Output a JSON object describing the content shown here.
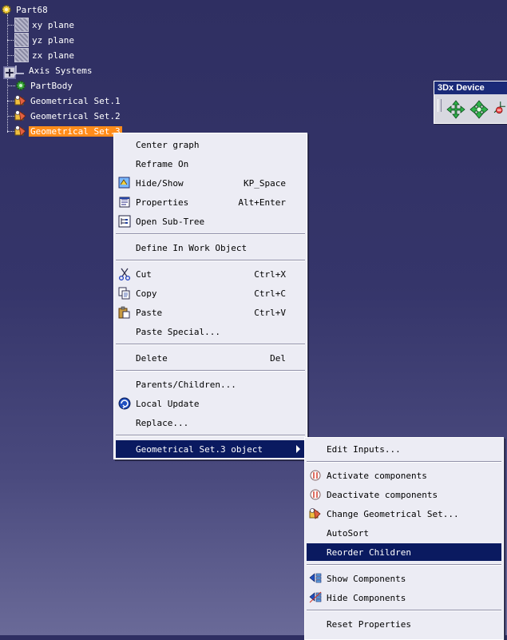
{
  "tree": {
    "root": "Part68",
    "nodes": [
      {
        "label": "xy plane",
        "icon": "plane-icon"
      },
      {
        "label": "yz plane",
        "icon": "plane-icon"
      },
      {
        "label": "zx plane",
        "icon": "plane-icon"
      },
      {
        "label": "Axis Systems",
        "icon": "axis-systems-icon"
      },
      {
        "label": "PartBody",
        "icon": "partbody-gear-icon"
      },
      {
        "label": "Geometrical Set.1",
        "icon": "geometrical-set-icon"
      },
      {
        "label": "Geometrical Set.2",
        "icon": "geometrical-set-icon"
      },
      {
        "label": "Geometrical Set.3",
        "icon": "geometrical-set-icon"
      }
    ]
  },
  "toolbar": {
    "title": "3Dx Device",
    "buttons": [
      "pan-arrows-icon",
      "rotate-arrows-icon",
      "zoom-icon"
    ]
  },
  "context_menu": {
    "items": [
      {
        "label": "Center graph",
        "shortcut": ""
      },
      {
        "label": "Reframe On",
        "shortcut": ""
      },
      {
        "label": "Hide/Show",
        "shortcut": "KP_Space",
        "icon": "hide-show-icon"
      },
      {
        "label": "Properties",
        "shortcut": "Alt+Enter",
        "icon": "properties-icon"
      },
      {
        "label": "Open Sub-Tree",
        "shortcut": "",
        "icon": "sub-tree-icon"
      },
      {
        "label": "Define In Work Object",
        "shortcut": ""
      },
      {
        "label": "Cut",
        "shortcut": "Ctrl+X",
        "icon": "scissors-icon"
      },
      {
        "label": "Copy",
        "shortcut": "Ctrl+C",
        "icon": "copy-icon"
      },
      {
        "label": "Paste",
        "shortcut": "Ctrl+V",
        "icon": "paste-icon"
      },
      {
        "label": "Paste Special...",
        "shortcut": ""
      },
      {
        "label": "Delete",
        "shortcut": "Del"
      },
      {
        "label": "Parents/Children...",
        "shortcut": ""
      },
      {
        "label": "Local Update",
        "shortcut": "",
        "icon": "local-update-icon"
      },
      {
        "label": "Replace...",
        "shortcut": ""
      },
      {
        "label": "Geometrical Set.3 object",
        "shortcut": ""
      }
    ]
  },
  "sub_menu": {
    "items": [
      {
        "label": "Edit Inputs..."
      },
      {
        "label": "Activate components",
        "icon": "activate-icon"
      },
      {
        "label": "Deactivate components",
        "icon": "deactivate-icon"
      },
      {
        "label": "Change Geometrical Set...",
        "icon": "change-set-icon"
      },
      {
        "label": "AutoSort"
      },
      {
        "label": "Reorder Children"
      },
      {
        "label": "Show Components",
        "icon": "show-components-icon"
      },
      {
        "label": "Hide Components",
        "icon": "hide-components-icon"
      },
      {
        "label": "Reset Properties"
      }
    ]
  },
  "colors": {
    "background": "#35356a",
    "selection": "#ff8c1a",
    "menu_highlight": "#0a1a60",
    "menu_bg": "#ececf4"
  }
}
